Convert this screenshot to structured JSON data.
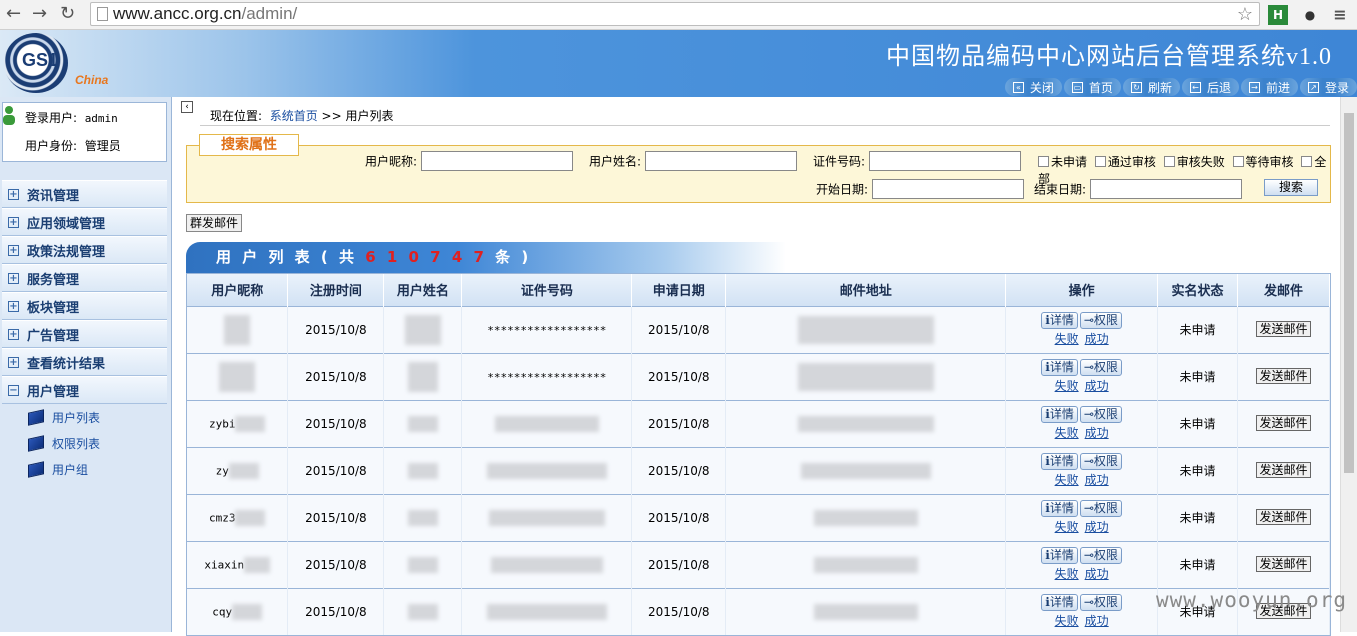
{
  "browser": {
    "url_host": "www.ancc.org.cn",
    "url_path": "/admin/"
  },
  "header": {
    "logo_text": "GS1",
    "logo_sub": "China",
    "title": "中国物品编码中心网站后台管理系统v1.0",
    "toolbar": [
      "关闭",
      "首页",
      "刷新",
      "后退",
      "前进",
      "登录"
    ]
  },
  "user": {
    "login_label": "登录用户:",
    "login_value": "admin",
    "role_label": "用户身份:",
    "role_value": "管理员"
  },
  "menu": {
    "items": [
      "资讯管理",
      "应用领域管理",
      "政策法规管理",
      "服务管理",
      "板块管理",
      "广告管理",
      "查看统计结果",
      "用户管理"
    ],
    "sub_items": [
      "用户列表",
      "权限列表",
      "用户组"
    ]
  },
  "breadcrumb": {
    "prefix": "现在位置:",
    "home": "系统首页",
    "sep": ">>",
    "current": "用户列表"
  },
  "search": {
    "legend": "搜索属性",
    "nickname_label": "用户昵称:",
    "name_label": "用户姓名:",
    "idno_label": "证件号码:",
    "start_label": "开始日期:",
    "end_label": "结束日期:",
    "checkboxes": [
      "未申请",
      "通过审核",
      "审核失败",
      "等待审核",
      "全部"
    ],
    "button": "搜索"
  },
  "mass_mail_button": "群发邮件",
  "list": {
    "title_pre": "用 户 列 表 ( 共 ",
    "count": "6 1 0 7 4 7",
    "title_post": " 条 )"
  },
  "table": {
    "headers": [
      "用户昵称",
      "注册时间",
      "用户姓名",
      "证件号码",
      "申请日期",
      "邮件地址",
      "操作",
      "实名状态",
      "发邮件"
    ],
    "detail_btn": "详情",
    "perm_btn": "权限",
    "fail_link": "失败",
    "success_link": "成功",
    "send_btn": "发送邮件",
    "rows": [
      {
        "nick": "",
        "reg": "2015/10/8",
        "idno": "******************",
        "apply": "2015/10/8",
        "status": "未申请"
      },
      {
        "nick": "",
        "reg": "2015/10/8",
        "idno": "******************",
        "apply": "2015/10/8",
        "status": "未申请"
      },
      {
        "nick": "zybi",
        "reg": "2015/10/8",
        "idno": "",
        "apply": "2015/10/8",
        "status": "未申请"
      },
      {
        "nick": "zy",
        "reg": "2015/10/8",
        "idno": "",
        "apply": "2015/10/8",
        "status": "未申请"
      },
      {
        "nick": "cmz3",
        "reg": "2015/10/8",
        "idno": "",
        "apply": "2015/10/8",
        "status": "未申请"
      },
      {
        "nick": "xiaxin",
        "reg": "2015/10/8",
        "idno": "",
        "apply": "2015/10/8",
        "status": "未申请"
      },
      {
        "nick": "cqy",
        "reg": "2015/10/8",
        "idno": "",
        "apply": "2015/10/8",
        "status": "未申请"
      }
    ]
  },
  "watermark": "www.wooyun.org"
}
